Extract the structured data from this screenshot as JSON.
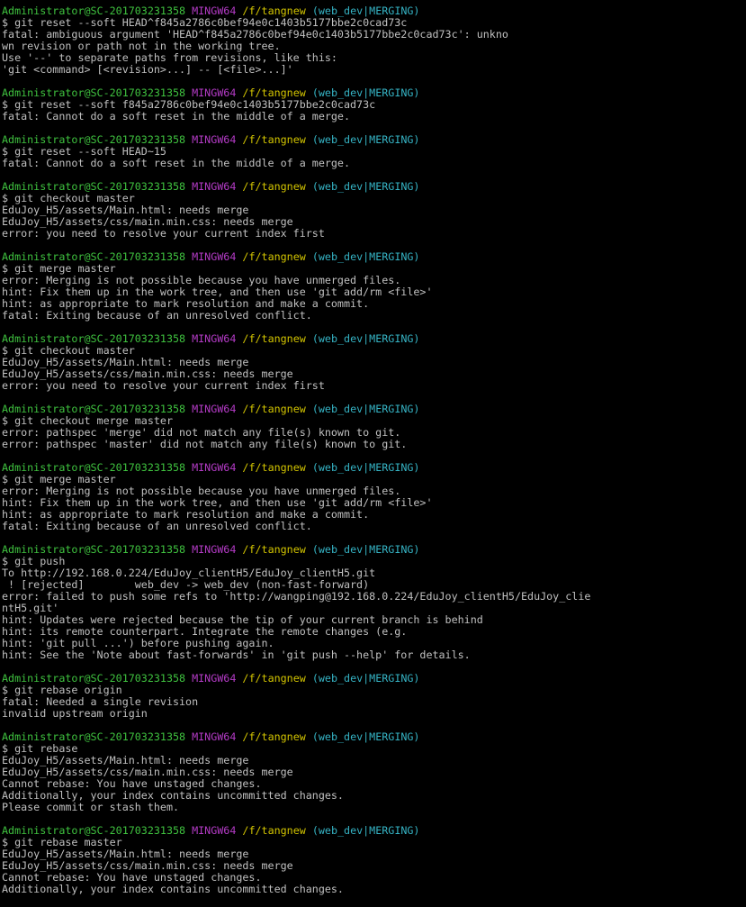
{
  "colors": {
    "background": "#000000",
    "text": "#c0c0c0",
    "user": "#3fc23f",
    "shell": "#b43bc6",
    "path": "#d2c400",
    "branch": "#35b3c4"
  },
  "prompt": {
    "user_host": "Administrator@SC-201703231358",
    "shell": "MINGW64",
    "path": "/f/tangnew",
    "branch": "(web_dev|MERGING)"
  },
  "blocks": [
    {
      "command": "$ git reset --soft HEAD^f845a2786c0bef94e0c1403b5177bbe2c0cad73c",
      "output": [
        "fatal: ambiguous argument 'HEAD^f845a2786c0bef94e0c1403b5177bbe2c0cad73c': unkno",
        "wn revision or path not in the working tree.",
        "Use '--' to separate paths from revisions, like this:",
        "'git <command> [<revision>...] -- [<file>...]'"
      ]
    },
    {
      "command": "$ git reset --soft f845a2786c0bef94e0c1403b5177bbe2c0cad73c",
      "output": [
        "fatal: Cannot do a soft reset in the middle of a merge."
      ]
    },
    {
      "command": "$ git reset --soft HEAD~15",
      "output": [
        "fatal: Cannot do a soft reset in the middle of a merge."
      ]
    },
    {
      "command": "$ git checkout master",
      "output": [
        "EduJoy_H5/assets/Main.html: needs merge",
        "EduJoy_H5/assets/css/main.min.css: needs merge",
        "error: you need to resolve your current index first"
      ]
    },
    {
      "command": "$ git merge master",
      "output": [
        "error: Merging is not possible because you have unmerged files.",
        "hint: Fix them up in the work tree, and then use 'git add/rm <file>'",
        "hint: as appropriate to mark resolution and make a commit.",
        "fatal: Exiting because of an unresolved conflict."
      ]
    },
    {
      "command": "$ git checkout master",
      "output": [
        "EduJoy_H5/assets/Main.html: needs merge",
        "EduJoy_H5/assets/css/main.min.css: needs merge",
        "error: you need to resolve your current index first"
      ]
    },
    {
      "command": "$ git checkout merge master",
      "output": [
        "error: pathspec 'merge' did not match any file(s) known to git.",
        "error: pathspec 'master' did not match any file(s) known to git."
      ]
    },
    {
      "command": "$ git merge master",
      "output": [
        "error: Merging is not possible because you have unmerged files.",
        "hint: Fix them up in the work tree, and then use 'git add/rm <file>'",
        "hint: as appropriate to mark resolution and make a commit.",
        "fatal: Exiting because of an unresolved conflict."
      ]
    },
    {
      "command": "$ git push",
      "output": [
        "To http://192.168.0.224/EduJoy_clientH5/EduJoy_clientH5.git",
        " ! [rejected]        web_dev -> web_dev (non-fast-forward)",
        "error: failed to push some refs to 'http://wangping@192.168.0.224/EduJoy_clientH5/EduJoy_clie",
        "ntH5.git'",
        "hint: Updates were rejected because the tip of your current branch is behind",
        "hint: its remote counterpart. Integrate the remote changes (e.g.",
        "hint: 'git pull ...') before pushing again.",
        "hint: See the 'Note about fast-forwards' in 'git push --help' for details."
      ]
    },
    {
      "command": "$ git rebase origin",
      "output": [
        "fatal: Needed a single revision",
        "invalid upstream origin"
      ]
    },
    {
      "command": "$ git rebase",
      "output": [
        "EduJoy_H5/assets/Main.html: needs merge",
        "EduJoy_H5/assets/css/main.min.css: needs merge",
        "Cannot rebase: You have unstaged changes.",
        "Additionally, your index contains uncommitted changes.",
        "Please commit or stash them."
      ]
    },
    {
      "command": "$ git rebase master",
      "output": [
        "EduJoy_H5/assets/Main.html: needs merge",
        "EduJoy_H5/assets/css/main.min.css: needs merge",
        "Cannot rebase: You have unstaged changes.",
        "Additionally, your index contains uncommitted changes."
      ]
    }
  ]
}
